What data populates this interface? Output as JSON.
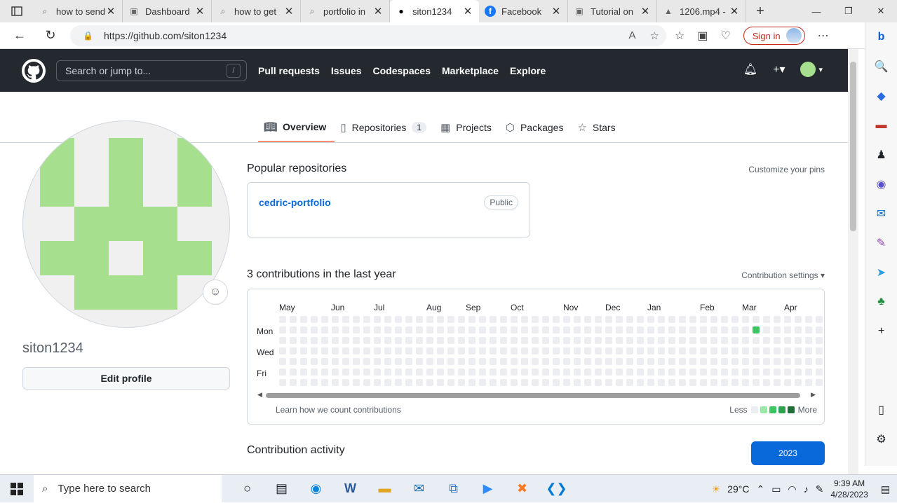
{
  "browser": {
    "tabs": [
      {
        "label": "how to send",
        "icon": "search-icon"
      },
      {
        "label": "Dashboard",
        "icon": "site-icon"
      },
      {
        "label": "how to get",
        "icon": "search-icon"
      },
      {
        "label": "portfolio in",
        "icon": "search-icon"
      },
      {
        "label": "siton1234",
        "icon": "github-icon",
        "active": true
      },
      {
        "label": "Facebook",
        "icon": "facebook-icon"
      },
      {
        "label": "Tutorial on",
        "icon": "site-icon"
      },
      {
        "label": "1206.mp4 -",
        "icon": "drive-icon"
      }
    ],
    "url": "https://github.com/siton1234",
    "sign_in": "Sign in"
  },
  "github": {
    "search_placeholder": "Search or jump to...",
    "search_key": "/",
    "nav": [
      "Pull requests",
      "Issues",
      "Codespaces",
      "Marketplace",
      "Explore"
    ]
  },
  "profile_tabs": [
    {
      "label": "Overview",
      "icon": "book-icon",
      "active": true
    },
    {
      "label": "Repositories",
      "icon": "repo-icon",
      "count": "1"
    },
    {
      "label": "Projects",
      "icon": "table-icon"
    },
    {
      "label": "Packages",
      "icon": "package-icon"
    },
    {
      "label": "Stars",
      "icon": "star-icon"
    }
  ],
  "profile": {
    "username": "siton1234",
    "edit_button": "Edit profile"
  },
  "popular": {
    "title": "Popular repositories",
    "customize": "Customize your pins",
    "repo_name": "cedric-portfolio",
    "repo_visibility": "Public"
  },
  "contributions": {
    "title": "3 contributions in the last year",
    "settings": "Contribution settings ▾",
    "months": [
      "May",
      "Jun",
      "Jul",
      "Aug",
      "Sep",
      "Oct",
      "Nov",
      "Dec",
      "Jan",
      "Feb",
      "Mar",
      "Apr"
    ],
    "days": [
      "Mon",
      "Wed",
      "Fri"
    ],
    "learn": "Learn how we count contributions",
    "less": "Less",
    "more": "More",
    "active_cell": {
      "week": 45,
      "day": 1
    },
    "colors": [
      "#ebedf0",
      "#9be9a8",
      "#40c463",
      "#30a14e",
      "#216e39"
    ]
  },
  "activity": {
    "title": "Contribution activity",
    "year": "2023"
  },
  "taskbar": {
    "search_placeholder": "Type here to search",
    "weather": "29°C",
    "time": "9:39 AM",
    "date": "4/28/2023"
  }
}
